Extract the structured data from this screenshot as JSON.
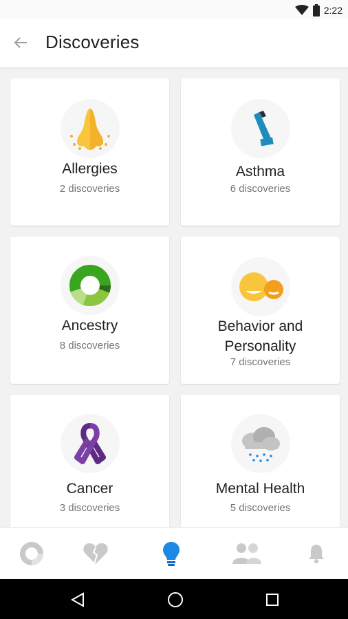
{
  "status_bar": {
    "time": "2:22",
    "icons": [
      "wifi-icon",
      "battery-icon"
    ]
  },
  "app_bar": {
    "title": "Discoveries",
    "back_icon": "arrow-left-icon"
  },
  "categories": [
    {
      "name": "Allergies",
      "count": "2 discoveries",
      "icon": "nose-icon"
    },
    {
      "name": "Asthma",
      "count": "6 discoveries",
      "icon": "inhaler-icon"
    },
    {
      "name": "Ancestry",
      "count": "8  discoveries",
      "icon": "ancestry-donut-icon"
    },
    {
      "name": "Behavior and",
      "name_line2": "Personality",
      "count": "7 discoveries",
      "icon": "faces-icon"
    },
    {
      "name": "Cancer",
      "count": "3 discoveries",
      "icon": "ribbon-icon"
    },
    {
      "name": "Mental Health",
      "count": "5 discoveries",
      "icon": "cloud-rain-icon"
    }
  ],
  "bottom_nav": {
    "items": [
      "dashboard-icon",
      "heart-icon",
      "lightbulb-icon",
      "people-icon",
      "bell-icon"
    ],
    "active": "lightbulb-icon",
    "colors": {
      "active": "#1e88e5",
      "inactive": "#c9c9c9"
    }
  },
  "system_nav": [
    "back-triangle-icon",
    "home-circle-icon",
    "recents-square-icon"
  ]
}
